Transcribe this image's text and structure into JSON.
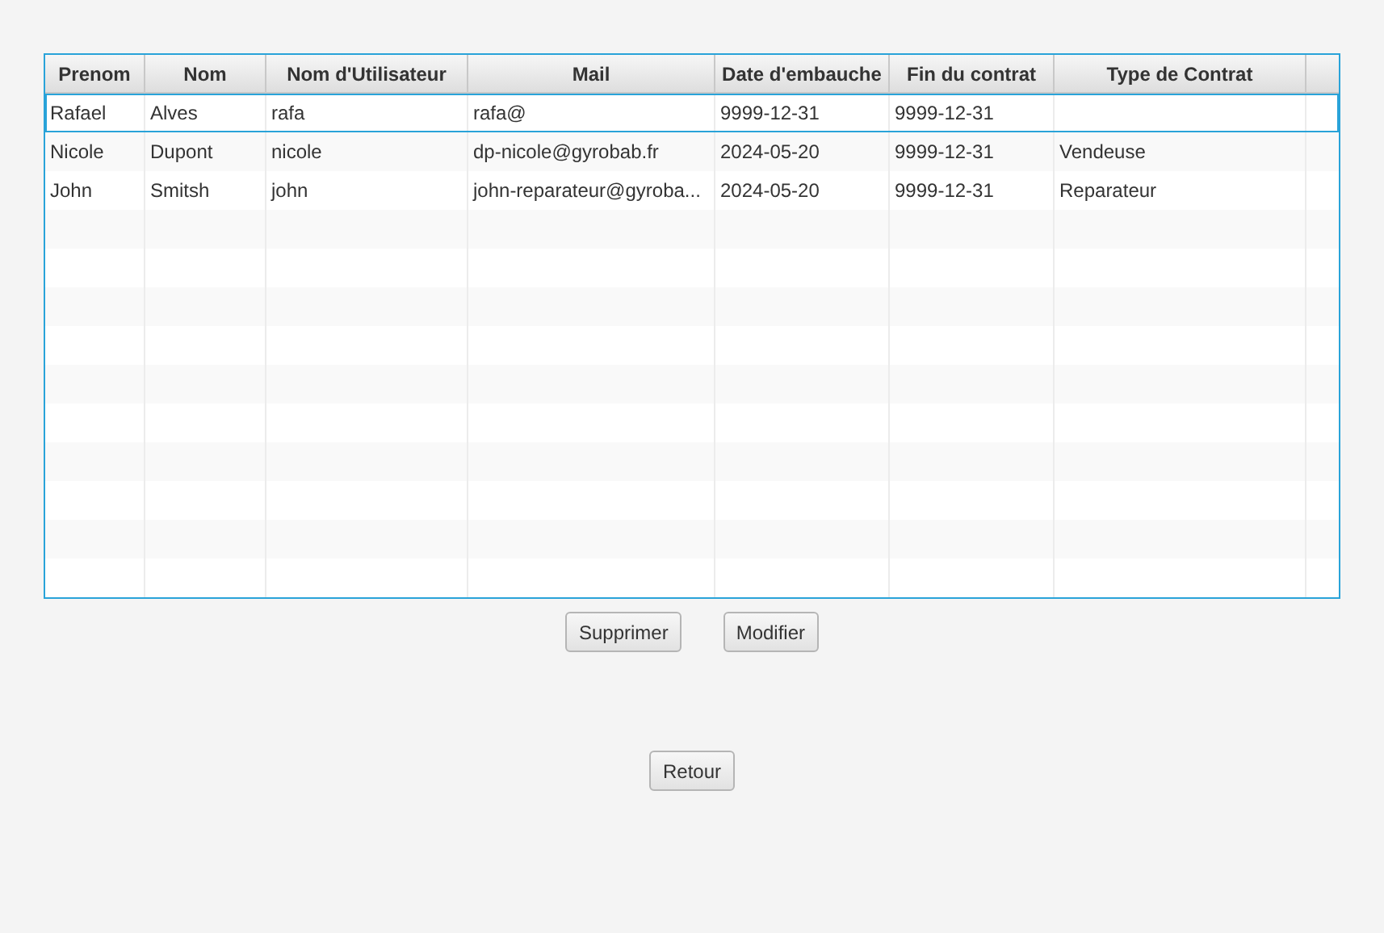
{
  "table": {
    "columns": [
      "Prenom",
      "Nom",
      "Nom d'Utilisateur",
      "Mail",
      "Date d'embauche",
      "Fin du contrat",
      "Type de Contrat"
    ],
    "rows": [
      {
        "cells": [
          "Rafael",
          "Alves",
          "rafa",
          "rafa@",
          "9999-12-31",
          "9999-12-31"
        ],
        "selected": true
      },
      {
        "cells": [
          "Nicole",
          "Dupont",
          "nicole",
          "dp-nicole@gyrobab.fr",
          "2024-05-20",
          "9999-12-31",
          "Vendeuse"
        ],
        "selected": false
      },
      {
        "cells": [
          "John",
          "Smitsh",
          "john",
          "john-reparateur@gyroba...",
          "2024-05-20",
          "9999-12-31",
          "Reparateur"
        ],
        "selected": false
      }
    ]
  },
  "actions": [
    "Supprimer",
    "Modifier"
  ],
  "back_button": "Retour"
}
